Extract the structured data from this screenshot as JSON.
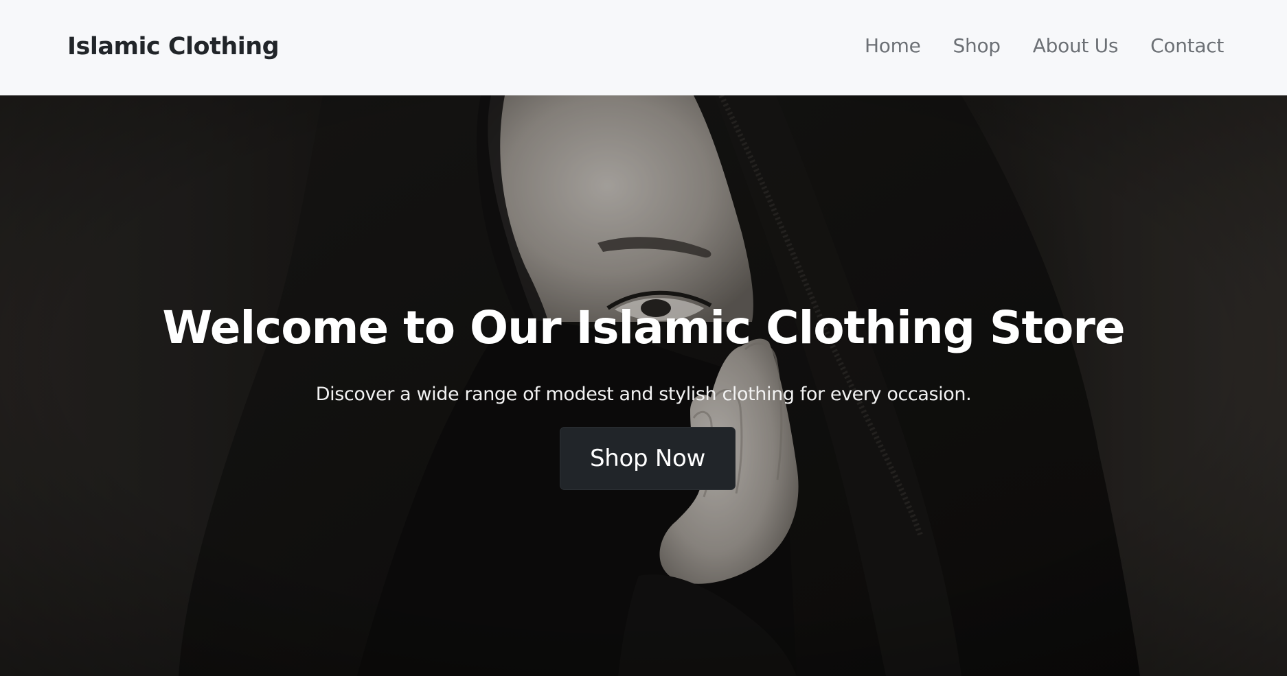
{
  "navbar": {
    "brand": "Islamic Clothing",
    "links": [
      "Home",
      "Shop",
      "About Us",
      "Contact"
    ]
  },
  "hero": {
    "title": "Welcome to Our Islamic Clothing Store",
    "subtitle": "Discover a wide range of modest and stylish clothing for every occasion.",
    "button_label": "Shop Now",
    "background_image": "woman-in-black-niqab-photo"
  },
  "colors": {
    "navbar_bg": "#f7f8fa",
    "brand_text": "#212529",
    "nav_link": "#6c7075",
    "button_bg": "#212529",
    "hero_text": "#ffffff"
  }
}
